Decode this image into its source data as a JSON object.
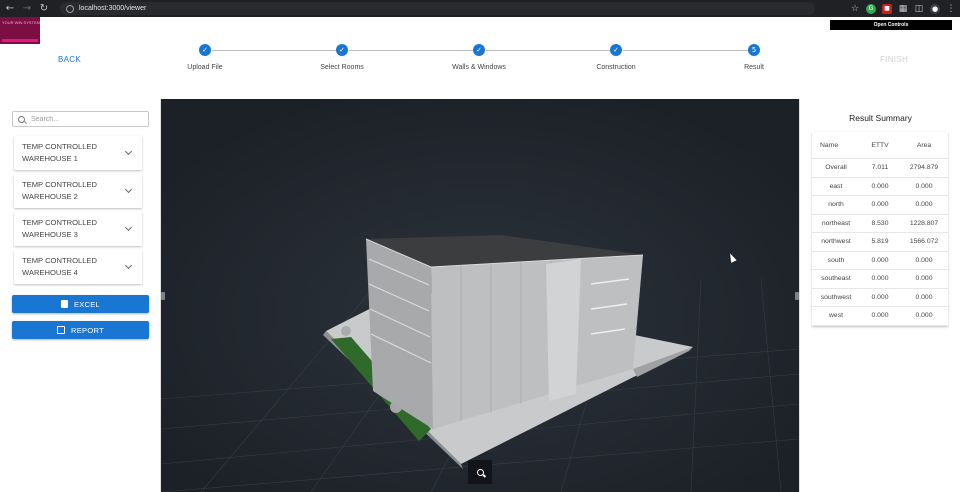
{
  "browser": {
    "url": "localhost:3000/viewer"
  },
  "header": {
    "logo_text": "YOUR WIN SYSTEM",
    "open_controls": "Open Controls",
    "back_label": "BACK",
    "finish_label": "FINISH",
    "steps": [
      {
        "label": "Upload File",
        "icon": "check-icon",
        "status": "completed"
      },
      {
        "label": "Select Rooms",
        "icon": "check-icon",
        "status": "completed"
      },
      {
        "label": "Walls & Windows",
        "icon": "check-icon",
        "status": "completed"
      },
      {
        "label": "Construction",
        "icon": "check-icon",
        "status": "completed"
      },
      {
        "label": "Result",
        "number": "5",
        "status": "active"
      }
    ]
  },
  "sidebar": {
    "search_placeholder": "Search...",
    "items": [
      {
        "line1": "TEMP CONTROLLED",
        "line2": "WAREHOUSE 1"
      },
      {
        "line1": "TEMP CONTROLLED",
        "line2": "WAREHOUSE 2"
      },
      {
        "line1": "TEMP CONTROLLED",
        "line2": "WAREHOUSE 3"
      },
      {
        "line1": "TEMP CONTROLLED",
        "line2": "WAREHOUSE 4"
      }
    ],
    "excel_label": "EXCEL",
    "report_label": "REPORT"
  },
  "summary": {
    "title": "Result Summary",
    "columns": [
      "Name",
      "ETTV",
      "Area"
    ],
    "rows": [
      [
        "Overall",
        "7.011",
        "2794.879"
      ],
      [
        "east",
        "0.000",
        "0.000"
      ],
      [
        "north",
        "0.000",
        "0.000"
      ],
      [
        "northeast",
        "8.530",
        "1228.807"
      ],
      [
        "northwest",
        "5.819",
        "1566.072"
      ],
      [
        "south",
        "0.000",
        "0.000"
      ],
      [
        "southeast",
        "0.000",
        "0.000"
      ],
      [
        "southwest",
        "0.000",
        "0.000"
      ],
      [
        "west",
        "0.000",
        "0.000"
      ]
    ]
  },
  "colors": {
    "primary": "#1976d2",
    "viewer_bg": "#1f252c",
    "logo_bg": "#7b0f44"
  }
}
